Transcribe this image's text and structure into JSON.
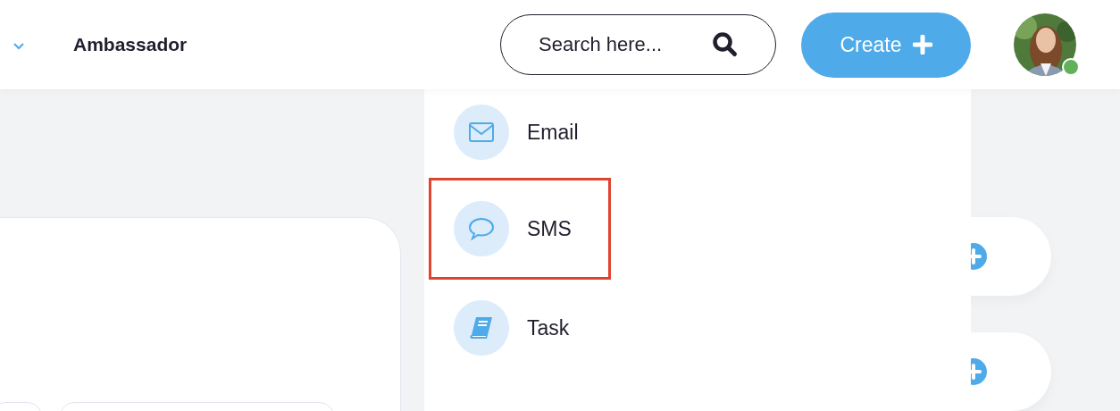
{
  "header": {
    "title": "Ambassador",
    "search": {
      "placeholder": "Search here..."
    },
    "create_button": {
      "label": "Create"
    },
    "avatar": {
      "online": true
    }
  },
  "create_menu": {
    "items": [
      {
        "kind": "email",
        "label": "Email",
        "highlighted": false
      },
      {
        "kind": "sms",
        "label": "SMS",
        "highlighted": true
      },
      {
        "kind": "task",
        "label": "Task",
        "highlighted": false
      }
    ]
  }
}
